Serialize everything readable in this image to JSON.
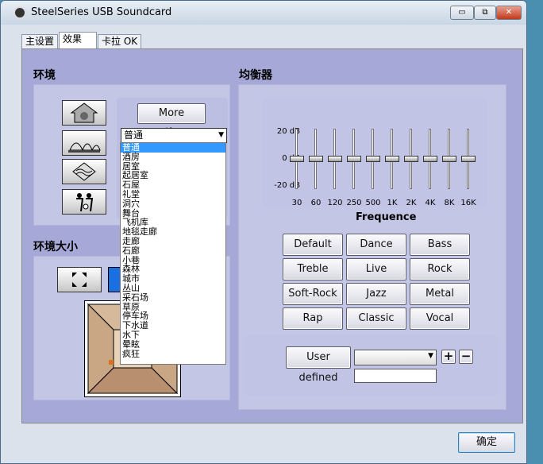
{
  "window": {
    "title": "SteelSeries USB Soundcard",
    "minimize_label": "▭",
    "maximize_label": "⧉",
    "close_label": "✕"
  },
  "tabs": [
    {
      "label": "主设置"
    },
    {
      "label": "效果"
    },
    {
      "label": "卡拉 OK"
    }
  ],
  "environment": {
    "heading": "环境",
    "more_options_label": "More options",
    "selected": "普通",
    "options": [
      "普通",
      "酒房",
      "居室",
      "起居室",
      "石屋",
      "礼堂",
      "洞穴",
      "舞台",
      "飞机库",
      "地毯走廊",
      "走廊",
      "石廊",
      "小巷",
      "森林",
      "城市",
      "丛山",
      "采石场",
      "草原",
      "停车场",
      "下水道",
      "水下",
      "晕眩",
      "疯狂"
    ],
    "icons": [
      "bathroom-icon",
      "opera-house-icon",
      "underwater-icon",
      "concert-icon"
    ]
  },
  "size": {
    "heading": "环境大小",
    "expand_icon": "expand-arrows-icon"
  },
  "equalizer": {
    "heading": "均衡器",
    "db_labels": [
      "20 dB",
      "0  dB",
      "-20 dB"
    ],
    "bands": [
      "30",
      "60",
      "120",
      "250",
      "500",
      "1K",
      "2K",
      "4K",
      "8K",
      "16K"
    ],
    "band_levels": [
      0,
      0,
      0,
      0,
      0,
      0,
      0,
      0,
      0,
      0
    ],
    "freq_label": "Frequence",
    "presets": [
      "Default",
      "Dance",
      "Bass",
      "Treble",
      "Live",
      "Rock",
      "Soft-Rock",
      "Jazz",
      "Metal",
      "Rap",
      "Classic",
      "Vocal"
    ],
    "user_defined_label": "User defined",
    "add_label": "+",
    "remove_label": "−"
  },
  "ok_label": "确定",
  "colors": {
    "client_bg": "#a6a9d7",
    "panel_bg": "#c4c6e6",
    "highlight": "#3399ff"
  }
}
